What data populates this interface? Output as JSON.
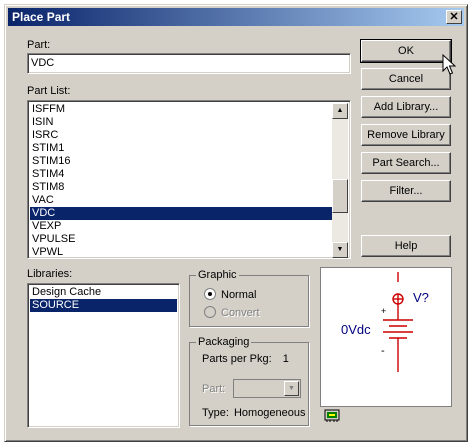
{
  "window": {
    "title": "Place Part",
    "close_glyph": "✕"
  },
  "part": {
    "label": "Part:",
    "value": "VDC"
  },
  "part_list": {
    "label": "Part List:",
    "items": [
      "ISFFM",
      "ISIN",
      "ISRC",
      "STIM1",
      "STIM16",
      "STIM4",
      "STIM8",
      "VAC",
      "VDC",
      "VEXP",
      "VPULSE",
      "VPWL"
    ],
    "selected": "VDC"
  },
  "libraries": {
    "label": "Libraries:",
    "items": [
      "Design Cache",
      "SOURCE"
    ],
    "selected": "SOURCE"
  },
  "buttons": {
    "ok": "OK",
    "cancel": "Cancel",
    "add_library": "Add Library...",
    "remove_library": "Remove Library",
    "part_search": "Part Search...",
    "filter": "Filter...",
    "help": "Help"
  },
  "graphic": {
    "title": "Graphic",
    "normal": "Normal",
    "convert": "Convert",
    "selected": "Normal"
  },
  "packaging": {
    "title": "Packaging",
    "parts_per_pkg_label": "Parts per Pkg:",
    "parts_per_pkg_value": "1",
    "part_label": "Part:",
    "part_value": "",
    "type_label": "Type:",
    "type_value": "Homogeneous"
  },
  "preview": {
    "value_label": "0Vdc",
    "ref_label": "V?",
    "plus": "+",
    "minus": "-",
    "symbol_color": "#cc0000",
    "label_color": "#000080"
  },
  "icons": {
    "scroll_up": "▲",
    "scroll_down": "▼",
    "combo_arrow": "▼"
  }
}
